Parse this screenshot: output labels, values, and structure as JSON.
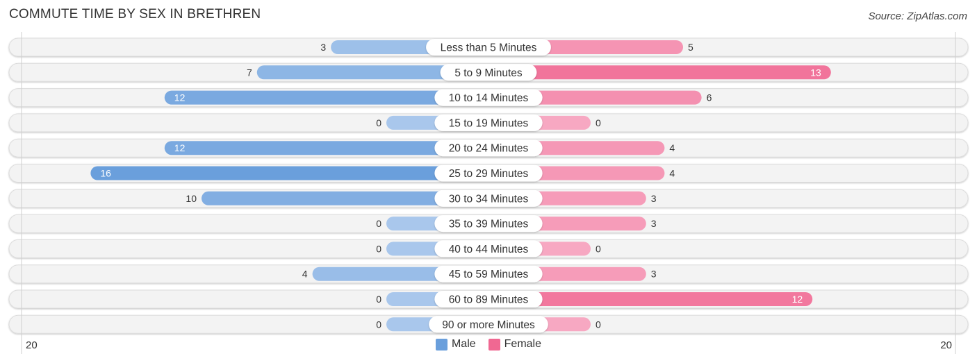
{
  "title": "COMMUTE TIME BY SEX IN BRETHREN",
  "source": "Source: ZipAtlas.com",
  "colors": {
    "male": "#6a9fdc",
    "male_light": "#a9c7ec",
    "female": "#f06892",
    "female_light": "#f7a8c2",
    "row_bg": "#f3f3f3"
  },
  "chart_data": {
    "type": "bar",
    "orientation": "horizontal-diverging",
    "title": "COMMUTE TIME BY SEX IN BRETHREN",
    "categories": [
      "Less than 5 Minutes",
      "5 to 9 Minutes",
      "10 to 14 Minutes",
      "15 to 19 Minutes",
      "20 to 24 Minutes",
      "25 to 29 Minutes",
      "30 to 34 Minutes",
      "35 to 39 Minutes",
      "40 to 44 Minutes",
      "45 to 59 Minutes",
      "60 to 89 Minutes",
      "90 or more Minutes"
    ],
    "series": [
      {
        "name": "Male",
        "values": [
          3,
          7,
          12,
          0,
          12,
          16,
          10,
          0,
          0,
          4,
          0,
          0
        ]
      },
      {
        "name": "Female",
        "values": [
          5,
          13,
          6,
          0,
          4,
          4,
          3,
          3,
          0,
          3,
          12,
          0
        ]
      }
    ],
    "axis": {
      "left_label": "20",
      "right_label": "20",
      "max": 20
    },
    "legend": {
      "position": "bottom-center",
      "items": [
        "Male",
        "Female"
      ]
    }
  }
}
